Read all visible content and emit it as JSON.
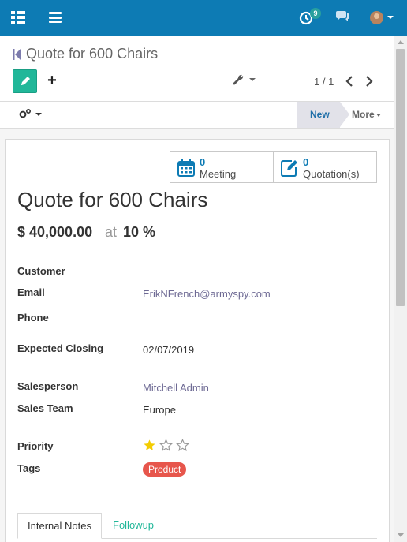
{
  "navbar": {
    "activity_count": "9",
    "brand_color": "#0d7bb4"
  },
  "control_panel": {
    "breadcrumb": "Quote for 600 Chairs",
    "create_label": "+",
    "pager": "1 / 1"
  },
  "statusbar": {
    "stage_current": "New",
    "more_label": "More"
  },
  "smart_buttons": {
    "meeting": {
      "count": "0",
      "label": "Meeting"
    },
    "quotation": {
      "count": "0",
      "label": "Quotation(s)"
    }
  },
  "record": {
    "title": "Quote for 600 Chairs",
    "revenue": "$ 40,000.00",
    "at": "at",
    "probability": "10 %"
  },
  "fields": {
    "customer": {
      "label": "Customer",
      "value": ""
    },
    "email": {
      "label": "Email",
      "value": "ErikNFrench@armyspy.com"
    },
    "phone": {
      "label": "Phone",
      "value": ""
    },
    "expected_closing": {
      "label": "Expected Closing",
      "value": "02/07/2019"
    },
    "salesperson": {
      "label": "Salesperson",
      "value": "Mitchell Admin"
    },
    "sales_team": {
      "label": "Sales Team",
      "value": "Europe"
    },
    "priority": {
      "label": "Priority",
      "stars_filled": 1,
      "stars_total": 3
    },
    "tags": {
      "label": "Tags",
      "items": [
        "Product"
      ]
    }
  },
  "tabs": [
    {
      "label": "Internal Notes",
      "active": true
    },
    {
      "label": "Followup",
      "active": false
    }
  ],
  "colors": {
    "accent_green": "#21b799",
    "tag_red": "#e7564c",
    "star_gold": "#f3cc00"
  },
  "icons": [
    "apps-icon",
    "menu-icon",
    "activity-clock-icon",
    "chat-icon",
    "avatar",
    "back-icon",
    "pencil-icon",
    "wrench-icon",
    "chevron-left-icon",
    "chevron-right-icon",
    "gears-icon",
    "calendar-icon",
    "edit-note-icon",
    "star-icon"
  ]
}
